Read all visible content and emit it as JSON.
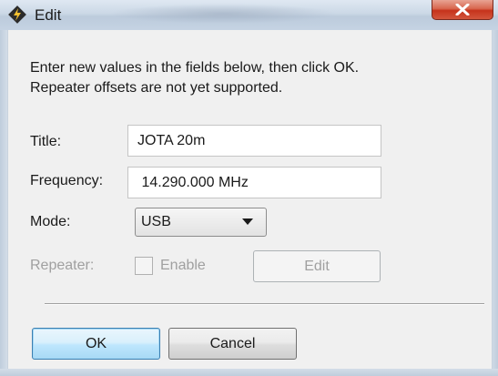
{
  "window": {
    "title": "Edit",
    "close_icon": "close-x-icon"
  },
  "instructions": {
    "line1": "Enter new values in the fields below, then click OK.",
    "line2": "Repeater offsets are not yet supported."
  },
  "fields": {
    "title_label": "Title:",
    "title_value": "JOTA 20m",
    "frequency_label": "Frequency:",
    "frequency_value": " 14.290.000 MHz",
    "mode_label": "Mode:",
    "mode_value": "USB",
    "repeater_label": "Repeater:",
    "repeater_enable_label": "Enable",
    "repeater_edit_label": "Edit"
  },
  "buttons": {
    "ok_label": "OK",
    "cancel_label": "Cancel"
  },
  "colors": {
    "close_button": "#c6331c",
    "default_button_border": "#3c7fb1",
    "disabled_text": "#a0a0a0"
  }
}
